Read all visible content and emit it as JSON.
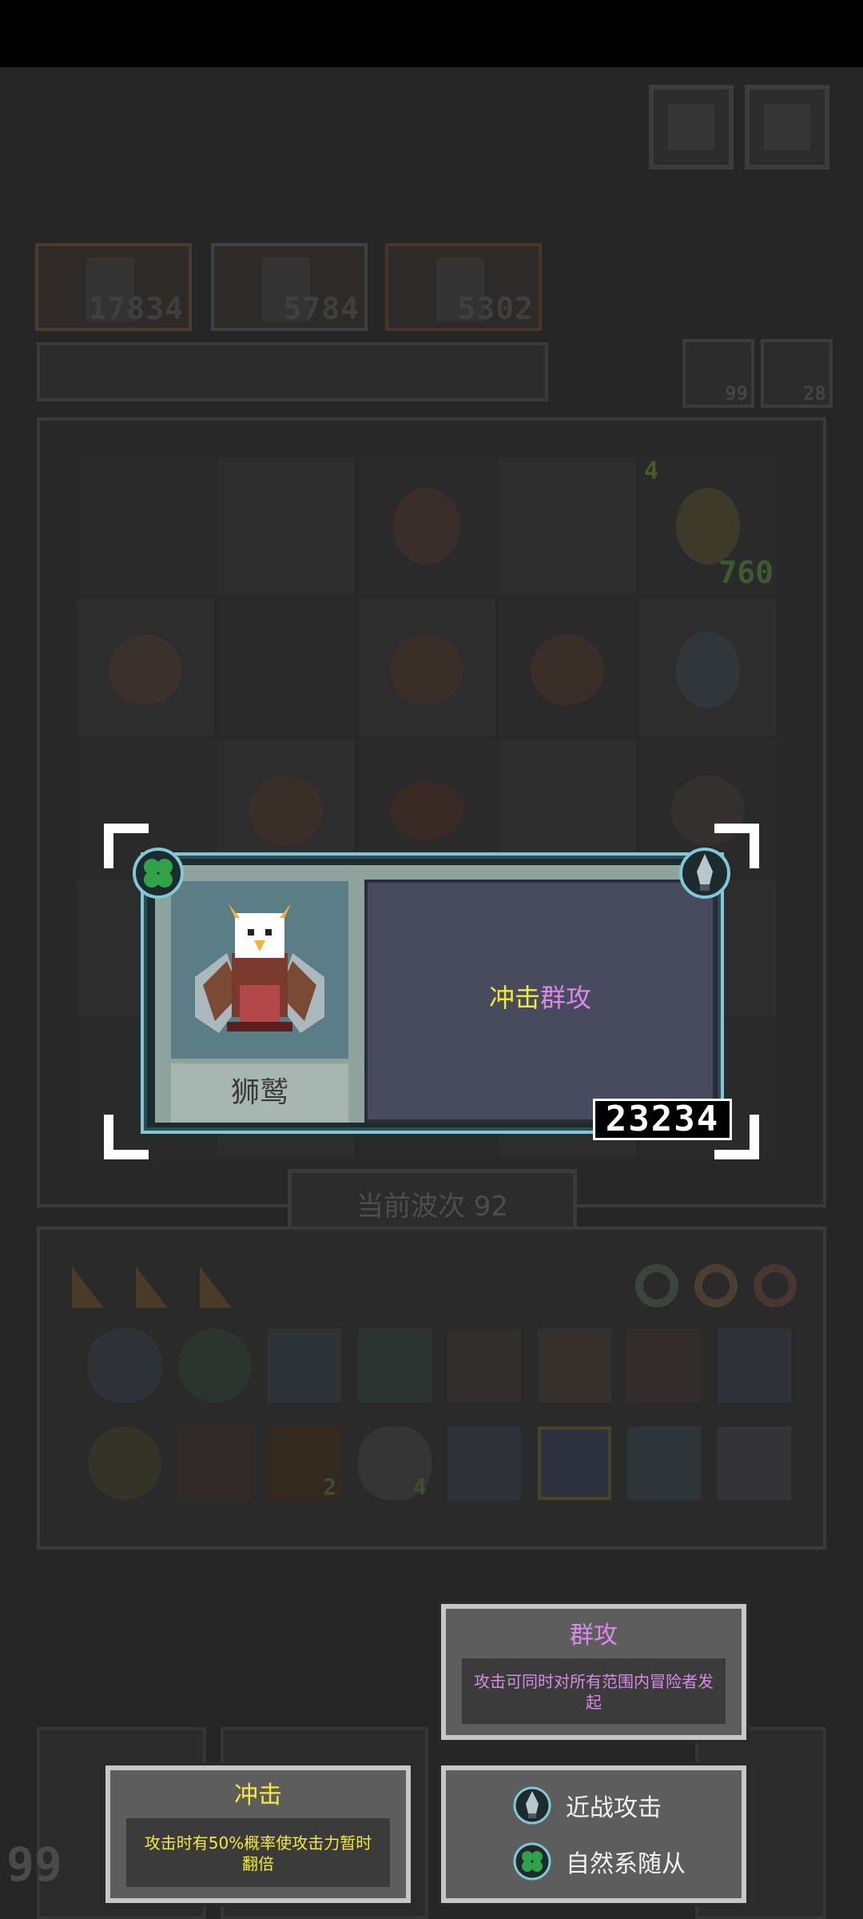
{
  "hud": {
    "heroes": [
      {
        "score": "17834"
      },
      {
        "score": "5784"
      },
      {
        "score": "5302"
      }
    ],
    "counters": [
      {
        "value": "99"
      },
      {
        "value": "28"
      }
    ],
    "grid_badge": {
      "level": "4",
      "value": "760"
    },
    "wave_label": "当前波次 92",
    "inventory_badges": [
      "2",
      "4"
    ],
    "left_counter": "99"
  },
  "unit_card": {
    "name": "狮鹫",
    "skills": [
      {
        "label": "冲击",
        "color": "#f2ea3a"
      },
      {
        "label": "群攻",
        "color": "#d78be6"
      }
    ],
    "score": "23234"
  },
  "tooltips": {
    "group_attack": {
      "title": "群攻",
      "title_color": "#d78be6",
      "desc": "攻击可同时对所有范围内冒险者发起",
      "desc_color": "#d78be6"
    },
    "impact": {
      "title": "冲击",
      "title_color": "#f2ea3a",
      "desc": "攻击时有50%概率使攻击力暂时翻倍",
      "desc_color": "#f2ea3a"
    },
    "attributes": [
      {
        "icon": "melee-sword-icon",
        "label": "近战攻击"
      },
      {
        "icon": "clover-icon",
        "label": "自然系随从"
      }
    ]
  },
  "colors": {
    "frame_cyan": "#7fc9d6",
    "clover_green": "#2fa24a"
  }
}
